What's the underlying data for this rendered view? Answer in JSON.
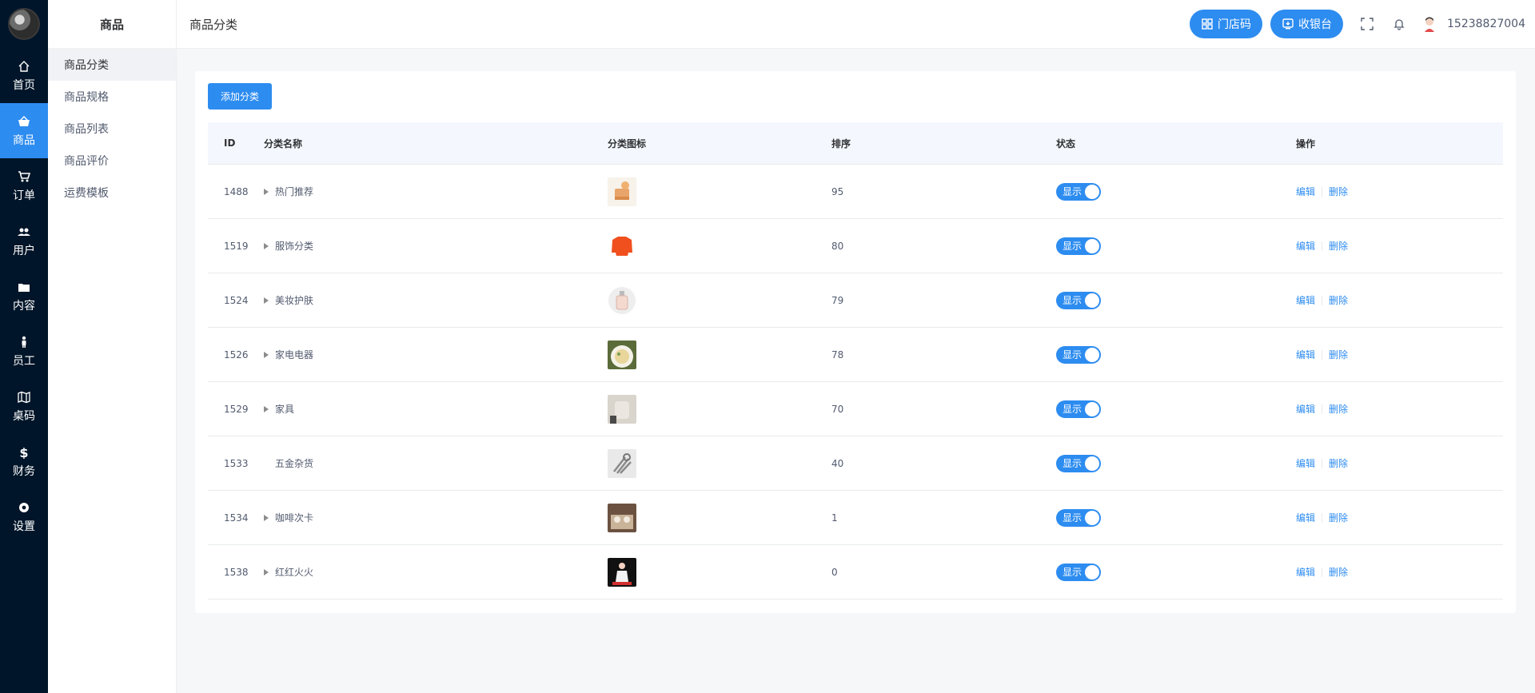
{
  "rail": {
    "items": [
      {
        "label": "首页",
        "icon": "home-icon"
      },
      {
        "label": "商品",
        "icon": "shop-basket-icon",
        "active": true
      },
      {
        "label": "订单",
        "icon": "cart-icon"
      },
      {
        "label": "用户",
        "icon": "users-icon"
      },
      {
        "label": "内容",
        "icon": "folder-icon"
      },
      {
        "label": "员工",
        "icon": "person-icon"
      },
      {
        "label": "桌码",
        "icon": "map-icon"
      },
      {
        "label": "财务",
        "icon": "dollar-icon"
      },
      {
        "label": "设置",
        "icon": "gear-icon"
      }
    ]
  },
  "submenu": {
    "title": "商品",
    "items": [
      "商品分类",
      "商品规格",
      "商品列表",
      "商品评价",
      "运费模板"
    ]
  },
  "header": {
    "breadcrumb": "商品分类",
    "store_code_label": "门店码",
    "cashier_label": "收银台",
    "username": "15238827004"
  },
  "content": {
    "add_button_label": "添加分类",
    "columns": [
      "ID",
      "分类名称",
      "分类图标",
      "排序",
      "状态",
      "操作"
    ],
    "rows": [
      {
        "id": "1488",
        "name": "热门推荐",
        "sort": "95",
        "status": "显示",
        "expandable": true
      },
      {
        "id": "1519",
        "name": "服饰分类",
        "sort": "80",
        "status": "显示",
        "expandable": true
      },
      {
        "id": "1524",
        "name": "美妆护肤",
        "sort": "79",
        "status": "显示",
        "expandable": true
      },
      {
        "id": "1526",
        "name": "家电电器",
        "sort": "78",
        "status": "显示",
        "expandable": true
      },
      {
        "id": "1529",
        "name": "家具",
        "sort": "70",
        "status": "显示",
        "expandable": true
      },
      {
        "id": "1533",
        "name": "五金杂货",
        "sort": "40",
        "status": "显示",
        "expandable": false
      },
      {
        "id": "1534",
        "name": "咖啡次卡",
        "sort": "1",
        "status": "显示",
        "expandable": true
      },
      {
        "id": "1538",
        "name": "红红火火",
        "sort": "0",
        "status": "显示",
        "expandable": true
      }
    ],
    "edit_label": "编辑",
    "delete_label": "删除"
  },
  "colors": {
    "primary": "#2d8cf0",
    "rail_bg": "#001529",
    "page_bg": "#f5f7f9"
  }
}
